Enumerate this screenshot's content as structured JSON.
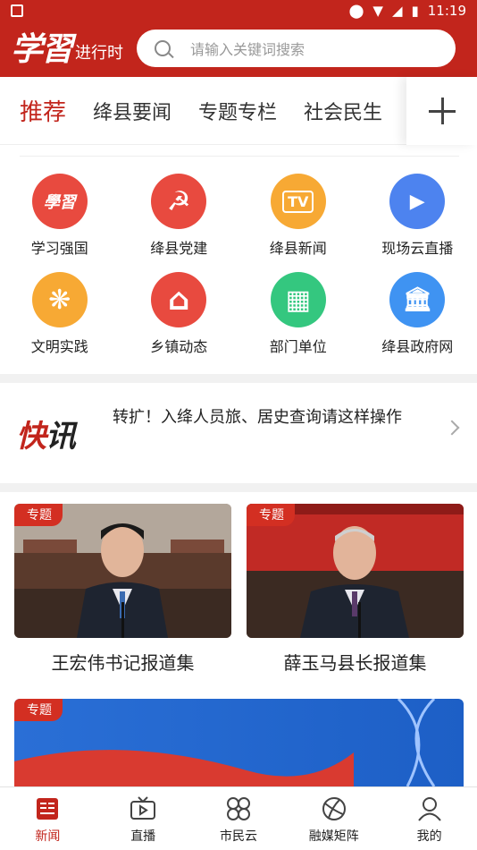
{
  "status_bar": {
    "time": "11:19"
  },
  "header": {
    "logo_text": "学習",
    "logo_subtext": "进行时",
    "search_placeholder": "请输入关键词搜索"
  },
  "tabs": [
    {
      "label": "推荐",
      "active": true
    },
    {
      "label": "绛县要闻"
    },
    {
      "label": "专题专栏"
    },
    {
      "label": "社会民生"
    }
  ],
  "shortcuts": [
    {
      "label": "学习强国",
      "icon": "xuexi-icon",
      "color": "#e53935",
      "glyph": "學習"
    },
    {
      "label": "绛县党建",
      "icon": "party-emblem-icon",
      "color": "#e53935",
      "glyph": "☭"
    },
    {
      "label": "绛县新闻",
      "icon": "tv-icon",
      "color": "#f5a623",
      "glyph": "TV"
    },
    {
      "label": "现场云直播",
      "icon": "video-camera-icon",
      "color": "#4a7cf0",
      "glyph": "▶"
    },
    {
      "label": "文明实践",
      "icon": "sun-fan-icon",
      "color": "#f5a623",
      "glyph": "❋"
    },
    {
      "label": "乡镇动态",
      "icon": "house-icon",
      "color": "#e53935",
      "glyph": "⌂"
    },
    {
      "label": "部门单位",
      "icon": "building-icon",
      "color": "#2ec37c",
      "glyph": "▦"
    },
    {
      "label": "绛县政府网",
      "icon": "government-icon",
      "color": "#3b8ef0",
      "glyph": "🏛"
    }
  ],
  "kuaixun": {
    "logo_red": "快",
    "logo_black": "讯",
    "headline": "转扩！入绛人员旅、居史查询请这样操作"
  },
  "cards": [
    {
      "badge": "专题",
      "caption": "王宏伟书记报道集"
    },
    {
      "badge": "专题",
      "caption": "薛玉马县长报道集"
    }
  ],
  "banner": {
    "badge": "专题"
  },
  "bottom_nav": [
    {
      "label": "新闻",
      "icon": "news-icon",
      "active": true
    },
    {
      "label": "直播",
      "icon": "tv-live-icon"
    },
    {
      "label": "市民云",
      "icon": "grid-cloud-icon"
    },
    {
      "label": "融媒矩阵",
      "icon": "planet-icon"
    },
    {
      "label": "我的",
      "icon": "user-icon"
    }
  ],
  "colors": {
    "brand_red": "#c2251c"
  }
}
